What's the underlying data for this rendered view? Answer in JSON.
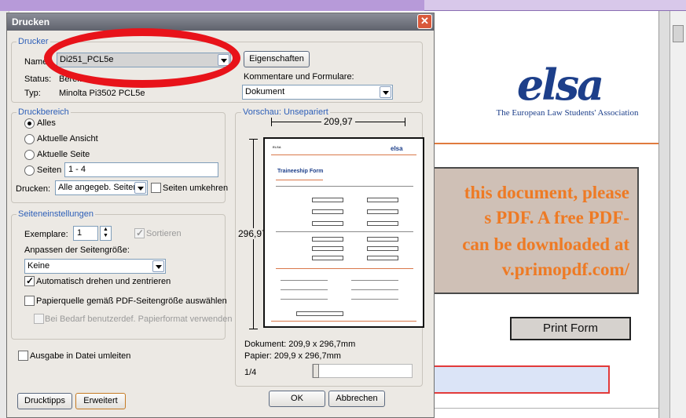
{
  "dialog": {
    "title": "Drucken",
    "printer_group": {
      "label": "Drucker",
      "name_label": "Name:",
      "name_value": "Di251_PCL5e",
      "status_label": "Status:",
      "status_value": "Bereit",
      "type_label": "Typ:",
      "type_value": "Minolta Pi3502 PCL5e",
      "properties_button": "Eigenschaften",
      "comments_label": "Kommentare und Formulare:",
      "comments_value": "Dokument"
    },
    "print_range": {
      "label": "Druckbereich",
      "options": [
        "Alles",
        "Aktuelle Ansicht",
        "Aktuelle Seite",
        "Seiten"
      ],
      "selected": "Alles",
      "pages_value": "1 - 4",
      "print_label": "Drucken:",
      "print_value": "Alle angegeb. Seiten",
      "reverse_label": "Seiten umkehren"
    },
    "page_settings": {
      "label": "Seiteneinstellungen",
      "copies_label": "Exemplare:",
      "copies_value": "1",
      "collate_label": "Sortieren",
      "fit_label": "Anpassen der Seitengröße:",
      "fit_value": "Keine",
      "auto_rotate_label": "Automatisch drehen und zentrieren",
      "paper_source_label": "Papierquelle gemäß PDF-Seitengröße auswählen",
      "custom_paper_label": "Bei Bedarf benutzerdef. Papierformat verwenden"
    },
    "preview": {
      "label": "Vorschau: Unsepariert",
      "width_value": "209,97",
      "height_value": "296,97",
      "document_size": "Dokument: 209,9 x 296,7mm",
      "paper_size": "Papier: 209,9 x 296,7mm",
      "page_indicator": "1/4",
      "page_position": 0.0,
      "form_title": "Traineeship Form"
    },
    "output_to_file_label": "Ausgabe in Datei umleiten",
    "tips_button": "Drucktipps",
    "advanced_button": "Erweitert",
    "ok_button": "OK",
    "cancel_button": "Abbrechen"
  },
  "background_document": {
    "logo": "elsa",
    "subtitle": "The European Law Students' Association",
    "notice_lines": [
      "this document, please",
      "s PDF.  A free PDF-",
      "can be downloaded at",
      "v.primopdf.com/"
    ],
    "print_form_button": "Print Form"
  },
  "colors": {
    "accent_blue": "#2d5fb8",
    "notice_orange": "#ee7a24",
    "annotation_red": "#e8131a",
    "elsa_blue": "#1d3f8a"
  }
}
